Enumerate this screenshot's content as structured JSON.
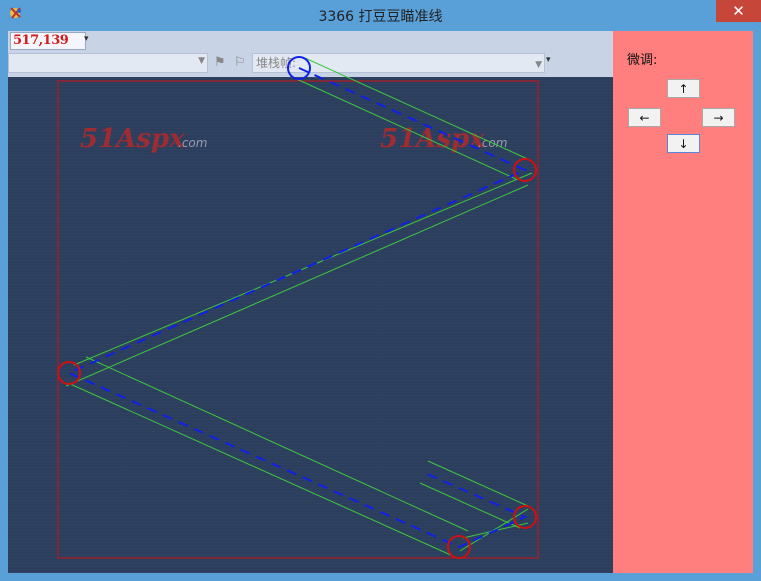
{
  "window": {
    "title": "3366 打豆豆瞄准线",
    "close_glyph": "✕",
    "icon": "app-icon"
  },
  "toolbar": {
    "coordinate_readout": "517,139",
    "left_combo_value": "",
    "right_combo_placeholder": "堆栈帧:",
    "flag_icons": [
      "flag-icon",
      "flag-filter-icon"
    ]
  },
  "game": {
    "watermark_text": "51Aspx",
    "watermark_suffix": ".com",
    "colors": {
      "frame": "#d01010",
      "aim_line": "#1020e8",
      "guide": "#3cc83c",
      "bounce_marker": "#d01010",
      "start_marker": "#1020e8"
    }
  },
  "side_panel": {
    "label": "微调:",
    "buttons": {
      "up": "↑",
      "left": "←",
      "right": "→",
      "down": "↓"
    }
  }
}
